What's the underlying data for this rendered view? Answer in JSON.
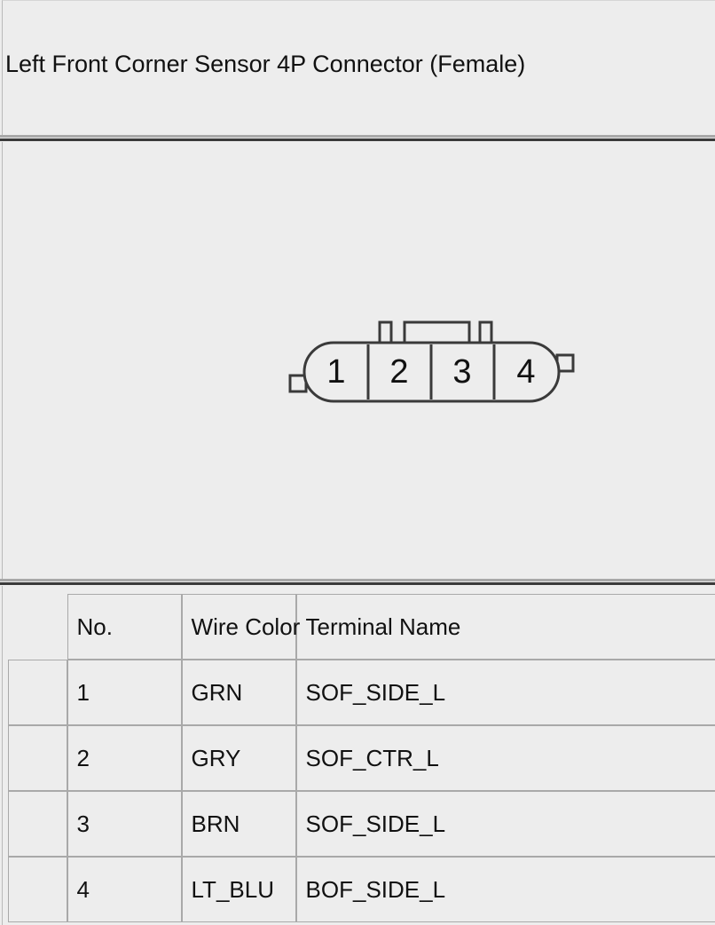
{
  "header": {
    "title": "Left Front Corner Sensor 4P Connector (Female)"
  },
  "connector": {
    "name": "Left Front Corner Sensor 4P Connector (Female)",
    "pin_count": 4,
    "pin_labels": [
      "1",
      "2",
      "3",
      "4"
    ],
    "gender": "Female",
    "view": "terminal-face",
    "features": {
      "body_shape": "rounded-rectangle",
      "top_tabs": [
        "narrow-left-tab",
        "wide-center-tab",
        "narrow-right-tab"
      ],
      "left_notch": "square-latch-left",
      "right_notch": "square-latch-right"
    }
  },
  "table": {
    "columns": [
      "No.",
      "Wire Color",
      "Terminal Name"
    ],
    "rows": [
      {
        "no": "1",
        "wire_color": "GRN",
        "terminal_name": "SOF_SIDE_L"
      },
      {
        "no": "2",
        "wire_color": "GRY",
        "terminal_name": "SOF_CTR_L"
      },
      {
        "no": "3",
        "wire_color": "BRN",
        "terminal_name": "SOF_SIDE_L"
      },
      {
        "no": "4",
        "wire_color": "LT_BLU",
        "terminal_name": "BOF_SIDE_L"
      }
    ]
  },
  "colors": {
    "page_background": "#ededed",
    "panel_background": "#ededed",
    "text": "#111111",
    "cell_border": "#a9a9a9",
    "rule_light": "#a8a8a8",
    "rule_dark": "#3a3a3a",
    "diagram_stroke": "#3a3a3a"
  }
}
